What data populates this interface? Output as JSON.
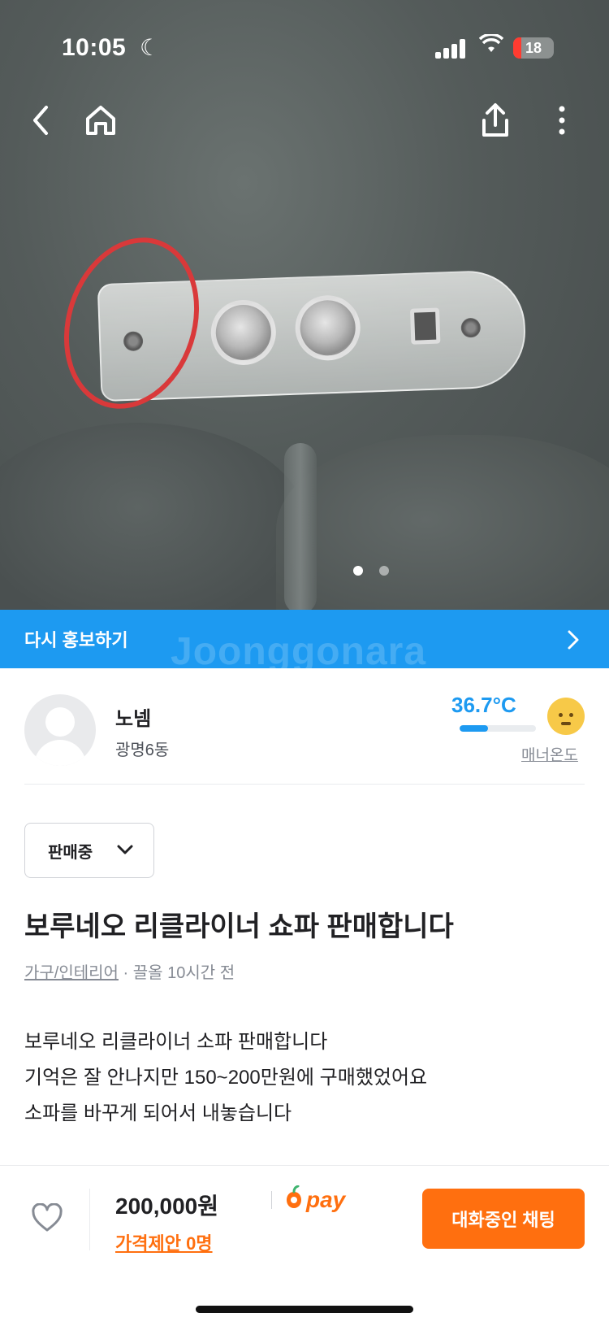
{
  "status_bar": {
    "time": "10:05",
    "moon_icon": "moon-icon",
    "battery": "18"
  },
  "nav": {
    "back_icon": "back-arrow-icon",
    "home_icon": "home-icon",
    "share_icon": "share-icon",
    "more_icon": "more-vertical-icon"
  },
  "gallery": {
    "image_count": 2,
    "active_index": 0
  },
  "promo": {
    "label": "다시 홍보하기",
    "watermark": "Joonggonara",
    "color": "#1d9af1"
  },
  "seller": {
    "name": "노넴",
    "region": "광명6동",
    "temperature": "36.7°C",
    "temperature_fraction": 0.37,
    "manner_label": "매너온도"
  },
  "listing": {
    "status": "판매중",
    "title": "보루네오 리클라이너 쇼파 판매합니다",
    "category": "가구/인테리어",
    "bump_time": " · 끌올 10시간 전",
    "description": [
      "보루네오 리클라이너 소파 판매합니다",
      "기억은 잘 안나지만 150~200만원에 구매했었어요",
      "소파를 바꾸게 되어서 내놓습니다"
    ]
  },
  "bottom_bar": {
    "price": "200,000원",
    "pay_label": "pay",
    "offer": "가격제안 0명",
    "chat_button": "대화중인 채팅",
    "accent": "#ff6f0f"
  }
}
